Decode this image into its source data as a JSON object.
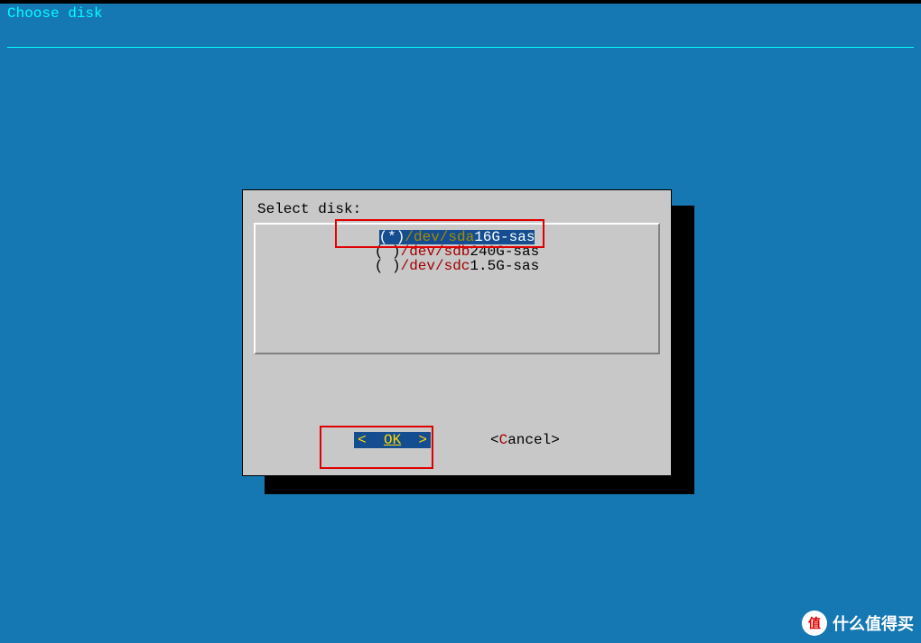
{
  "header": {
    "title": "Choose disk"
  },
  "dialog": {
    "title": "Select disk:",
    "items": [
      {
        "selected": true,
        "marker": "(*)",
        "device": "/dev/sda",
        "size": "16G-sas"
      },
      {
        "selected": false,
        "marker": "( )",
        "device": "/dev/sdb",
        "size": "240G-sas"
      },
      {
        "selected": false,
        "marker": "( )",
        "device": "/dev/sdc",
        "size": "1.5G-sas"
      }
    ],
    "buttons": {
      "ok_left": "<  ",
      "ok_label": "OK",
      "ok_right": "  >",
      "cancel_left": "<",
      "cancel_first": "C",
      "cancel_rest": "ancel",
      "cancel_right": ">"
    }
  },
  "watermark": {
    "badge": "值",
    "text": "什么值得买"
  }
}
